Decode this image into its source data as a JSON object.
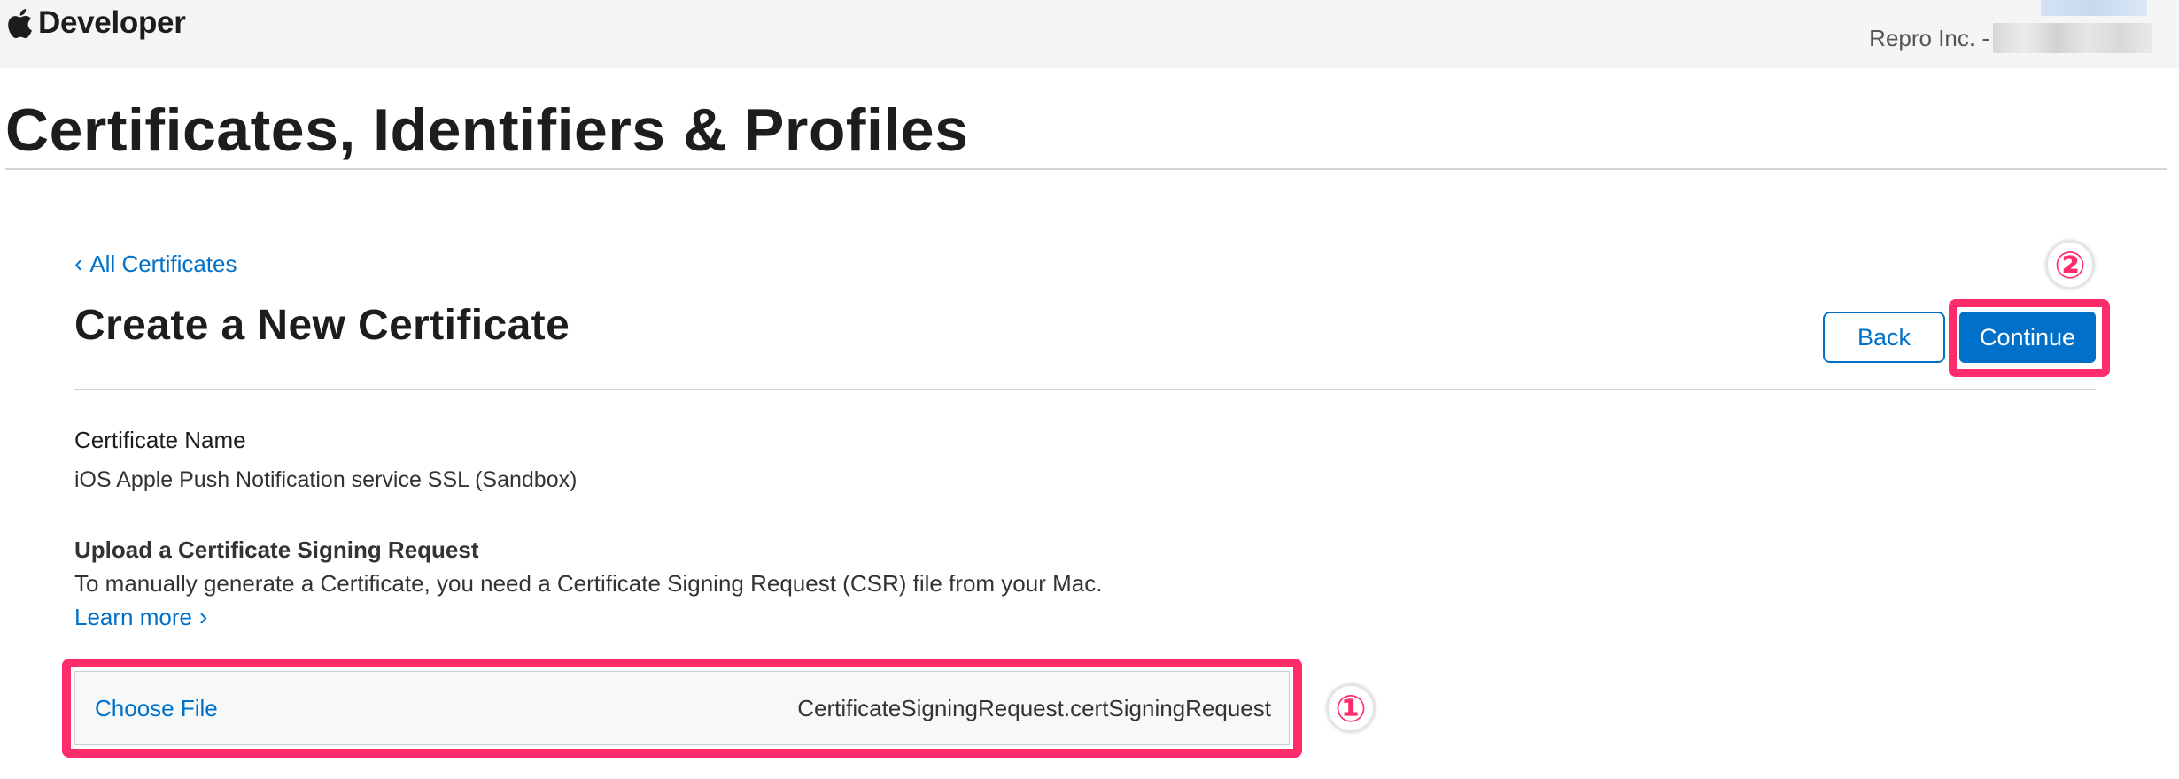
{
  "header": {
    "brand": "Developer",
    "account_name": "Repro Inc. -"
  },
  "page": {
    "title": "Certificates, Identifiers & Profiles"
  },
  "nav": {
    "back_link": "All Certificates"
  },
  "section": {
    "title": "Create a New Certificate",
    "back_label": "Back",
    "continue_label": "Continue"
  },
  "certificate": {
    "name_label": "Certificate Name",
    "name_value": "iOS Apple Push Notification service SSL (Sandbox)"
  },
  "upload": {
    "label": "Upload a Certificate Signing Request",
    "description": "To manually generate a Certificate, you need a Certificate Signing Request (CSR) file from your Mac.",
    "learn_more": "Learn more",
    "choose_file": "Choose File",
    "file_name": "CertificateSigningRequest.certSigningRequest"
  },
  "annotations": {
    "marker_1": "①",
    "marker_2": "②"
  },
  "icons": {
    "brand": "apple-icon",
    "back": "chevron-left-icon",
    "learn_more": "chevron-right-icon"
  },
  "colors": {
    "link": "#0070c9",
    "highlight": "#fd2c6a",
    "topbar": "#f5f5f7"
  }
}
